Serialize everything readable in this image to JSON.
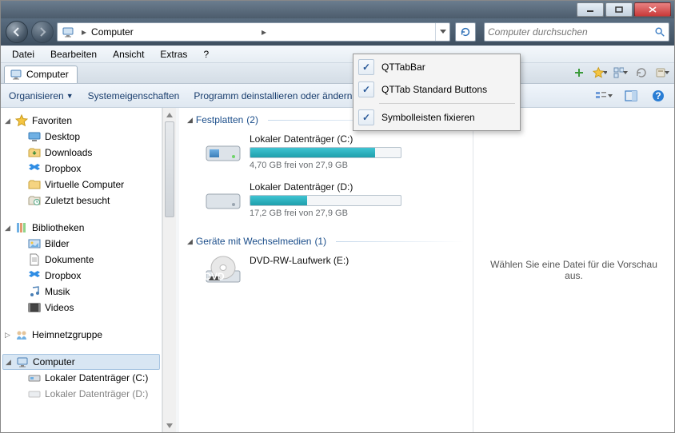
{
  "titlebar": {
    "minimize": "minimize",
    "maximize": "maximize",
    "close": "close"
  },
  "nav": {
    "location_root": "Computer",
    "search_placeholder": "Computer durchsuchen"
  },
  "menubar": {
    "items": [
      "Datei",
      "Bearbeiten",
      "Ansicht",
      "Extras",
      "?"
    ]
  },
  "tab": {
    "label": "Computer"
  },
  "toolbar": {
    "organize": "Organisieren",
    "system_properties": "Systemeigenschaften",
    "uninstall": "Programm deinstallieren oder ändern"
  },
  "dropdown": {
    "items": [
      {
        "label": "QTTabBar",
        "checked": true
      },
      {
        "label": "QTTab Standard Buttons",
        "checked": true
      }
    ],
    "pin": {
      "label": "Symbolleisten fixieren",
      "checked": true
    }
  },
  "sidebar": {
    "favorites": {
      "header": "Favoriten",
      "items": [
        "Desktop",
        "Downloads",
        "Dropbox",
        "Virtuelle Computer",
        "Zuletzt besucht"
      ]
    },
    "libraries": {
      "header": "Bibliotheken",
      "items": [
        "Bilder",
        "Dokumente",
        "Dropbox",
        "Musik",
        "Videos"
      ]
    },
    "homegroup": {
      "header": "Heimnetzgruppe"
    },
    "computer": {
      "header": "Computer",
      "items": [
        "Lokaler Datenträger (C:)",
        "Lokaler Datenträger (D:)"
      ]
    }
  },
  "content": {
    "hard_drives": {
      "header": "Festplatten",
      "count": "(2)",
      "drives": [
        {
          "name": "Lokaler Datenträger (C:)",
          "status": "4,70 GB frei von 27,9 GB",
          "fill_pct": 83
        },
        {
          "name": "Lokaler Datenträger (D:)",
          "status": "17,2 GB frei von 27,9 GB",
          "fill_pct": 38
        }
      ]
    },
    "removable": {
      "header": "Geräte mit Wechselmedien",
      "count": "(1)",
      "drives": [
        {
          "name": "DVD-RW-Laufwerk (E:)"
        }
      ]
    }
  },
  "preview": {
    "empty_text": "Wählen Sie eine Datei für die Vorschau aus."
  }
}
